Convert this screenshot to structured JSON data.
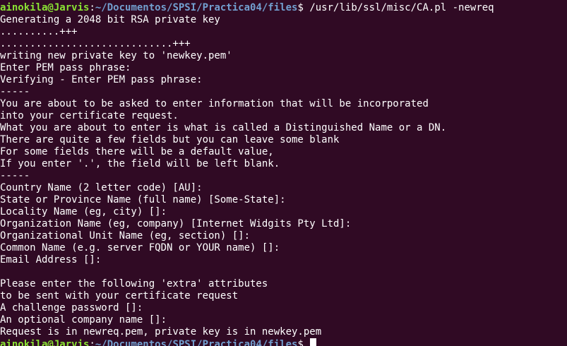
{
  "terminal": {
    "background": "#300a24",
    "foreground": "#ffffff",
    "prompt_user_color": "#8ae234",
    "prompt_path_color": "#729fcf",
    "prompt_1": {
      "user_host": "ainokila@Jarvis",
      "separator": ":",
      "path": "~/Documentos/SPSI/Practica04/files",
      "symbol": "$ ",
      "command": "/usr/lib/ssl/misc/CA.pl -newreq"
    },
    "output": [
      "Generating a 2048 bit RSA private key",
      "..........+++",
      ".............................+++",
      "writing new private key to 'newkey.pem'",
      "Enter PEM pass phrase:",
      "Verifying - Enter PEM pass phrase:",
      "-----",
      "You are about to be asked to enter information that will be incorporated",
      "into your certificate request.",
      "What you are about to enter is what is called a Distinguished Name or a DN.",
      "There are quite a few fields but you can leave some blank",
      "For some fields there will be a default value,",
      "If you enter '.', the field will be left blank.",
      "-----",
      "Country Name (2 letter code) [AU]:",
      "State or Province Name (full name) [Some-State]:",
      "Locality Name (eg, city) []:",
      "Organization Name (eg, company) [Internet Widgits Pty Ltd]:",
      "Organizational Unit Name (eg, section) []:",
      "Common Name (e.g. server FQDN or YOUR name) []:",
      "Email Address []:",
      "",
      "Please enter the following 'extra' attributes",
      "to be sent with your certificate request",
      "A challenge password []:",
      "An optional company name []:",
      "Request is in newreq.pem, private key is in newkey.pem"
    ],
    "prompt_2": {
      "user_host": "ainokila@Jarvis",
      "separator": ":",
      "path": "~/Documentos/SPSI/Practica04/files",
      "symbol": "$ ",
      "command": ""
    }
  }
}
